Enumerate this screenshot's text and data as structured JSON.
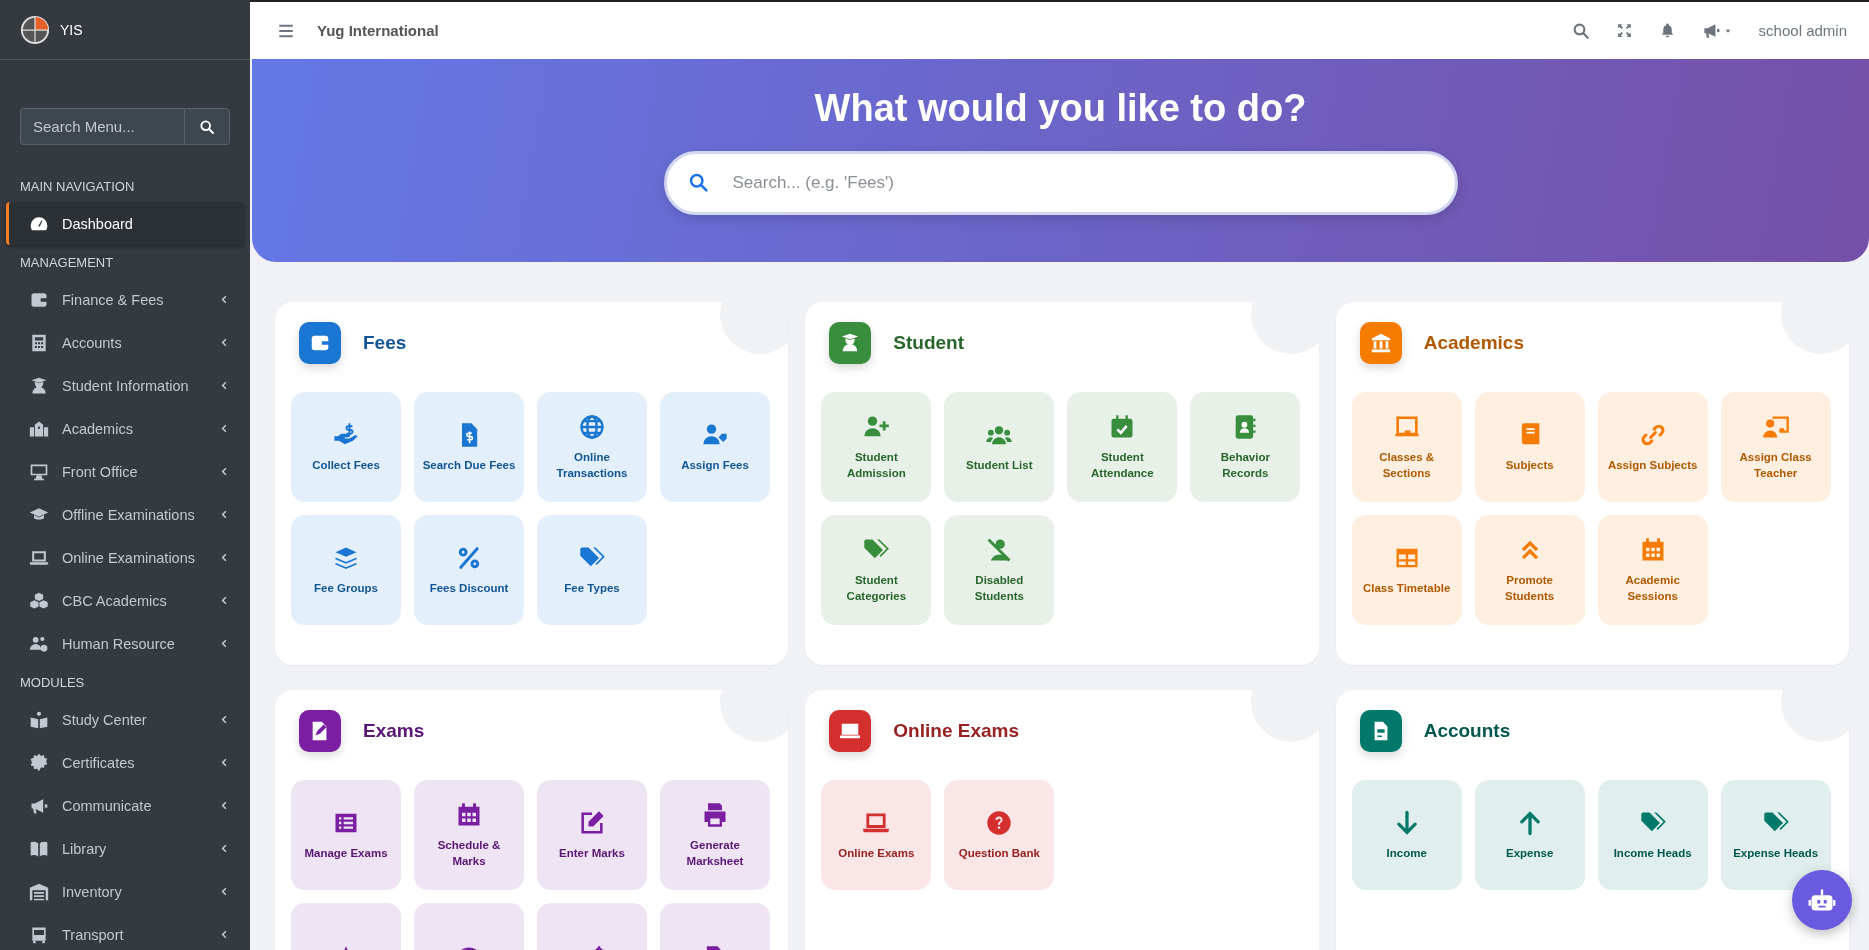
{
  "sidebar": {
    "brand": "YIS",
    "search": {
      "placeholder": "Search Menu..."
    },
    "groups": [
      {
        "heading": "MAIN NAVIGATION",
        "items": [
          {
            "label": "Dashboard",
            "selected": true,
            "expandable": false
          }
        ]
      },
      {
        "heading": "MANAGEMENT",
        "items": [
          {
            "label": "Finance & Fees",
            "selected": false,
            "expandable": true
          },
          {
            "label": "Accounts",
            "selected": false,
            "expandable": true
          },
          {
            "label": "Student Information",
            "selected": false,
            "expandable": true
          },
          {
            "label": "Academics",
            "selected": false,
            "expandable": true
          },
          {
            "label": "Front Office",
            "selected": false,
            "expandable": true
          },
          {
            "label": "Offline Examinations",
            "selected": false,
            "expandable": true
          },
          {
            "label": "Online Examinations",
            "selected": false,
            "expandable": true
          },
          {
            "label": "CBC Academics",
            "selected": false,
            "expandable": true
          },
          {
            "label": "Human Resource",
            "selected": false,
            "expandable": true
          }
        ]
      },
      {
        "heading": "MODULES",
        "items": [
          {
            "label": "Study Center",
            "selected": false,
            "expandable": true
          },
          {
            "label": "Certificates",
            "selected": false,
            "expandable": true
          },
          {
            "label": "Communicate",
            "selected": false,
            "expandable": true
          },
          {
            "label": "Library",
            "selected": false,
            "expandable": true
          },
          {
            "label": "Inventory",
            "selected": false,
            "expandable": true
          },
          {
            "label": "Transport",
            "selected": false,
            "expandable": true
          }
        ]
      }
    ]
  },
  "header": {
    "title": "Yug International",
    "user": "school admin"
  },
  "hero": {
    "title": "What would you like to do?",
    "search": {
      "placeholder": "Search... (e.g. 'Fees')"
    }
  },
  "sections": [
    {
      "title": "Fees",
      "color": "#1976d2",
      "tiles": [
        {
          "label": "Collect Fees"
        },
        {
          "label": "Search Due Fees"
        },
        {
          "label": "Online Transactions"
        },
        {
          "label": "Assign Fees"
        },
        {
          "label": "Fee Groups"
        },
        {
          "label": "Fees Discount"
        },
        {
          "label": "Fee Types"
        }
      ]
    },
    {
      "title": "Student",
      "color": "#388e3c",
      "tiles": [
        {
          "label": "Student Admission"
        },
        {
          "label": "Student List"
        },
        {
          "label": "Student Attendance"
        },
        {
          "label": "Behavior Records"
        },
        {
          "label": "Student Categories"
        },
        {
          "label": "Disabled Students"
        }
      ]
    },
    {
      "title": "Academics",
      "color": "#f57c00",
      "tiles": [
        {
          "label": "Classes & Sections"
        },
        {
          "label": "Subjects"
        },
        {
          "label": "Assign Subjects"
        },
        {
          "label": "Assign Class Teacher"
        },
        {
          "label": "Class Timetable"
        },
        {
          "label": "Promote Students"
        },
        {
          "label": "Academic Sessions"
        }
      ]
    },
    {
      "title": "Exams",
      "color": "#7b1fa2",
      "tiles": [
        {
          "kind": "labelled",
          "label": "Manage Exams"
        },
        {
          "kind": "labelled",
          "label": "Schedule & Marks"
        },
        {
          "kind": "labelled",
          "label": "Enter Marks"
        },
        {
          "kind": "labelled",
          "label": "Generate Marksheet"
        },
        {
          "kind": "icon-only"
        },
        {
          "kind": "icon-only"
        },
        {
          "kind": "icon-only"
        },
        {
          "kind": "icon-only"
        }
      ]
    },
    {
      "title": "Online Exams",
      "color": "#d32f2f",
      "tiles": [
        {
          "label": "Online Exams"
        },
        {
          "label": "Question Bank"
        }
      ]
    },
    {
      "title": "Accounts",
      "color": "#00796b",
      "tiles": [
        {
          "label": "Income"
        },
        {
          "label": "Expense"
        },
        {
          "label": "Income Heads"
        },
        {
          "label": "Expense Heads"
        }
      ]
    }
  ]
}
